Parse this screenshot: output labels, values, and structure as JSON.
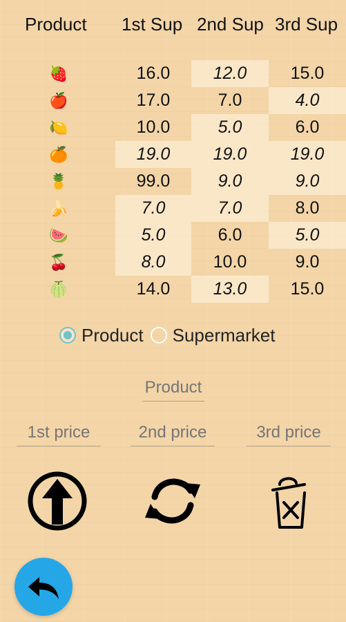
{
  "table": {
    "headers": {
      "product": "Product",
      "sup1": "1st Sup",
      "sup2": "2nd Sup",
      "sup3": "3rd Sup"
    },
    "rows": [
      {
        "icon": "🍓",
        "icon_name": "strawberry-icon",
        "p1": "16.0",
        "p2": "12.0",
        "p3": "15.0",
        "hl": [
          false,
          true,
          false
        ]
      },
      {
        "icon": "🍎",
        "icon_name": "apple-icon",
        "p1": "17.0",
        "p2": "7.0",
        "p3": "4.0",
        "hl": [
          false,
          false,
          true
        ]
      },
      {
        "icon": "🍋",
        "icon_name": "lemon-icon",
        "p1": "10.0",
        "p2": "5.0",
        "p3": "6.0",
        "hl": [
          false,
          true,
          false
        ]
      },
      {
        "icon": "🍊",
        "icon_name": "orange-icon",
        "p1": "19.0",
        "p2": "19.0",
        "p3": "19.0",
        "hl": [
          true,
          true,
          true
        ]
      },
      {
        "icon": "🍍",
        "icon_name": "pineapple-icon",
        "p1": "99.0",
        "p2": "9.0",
        "p3": "9.0",
        "hl": [
          false,
          true,
          true
        ]
      },
      {
        "icon": "🍌",
        "icon_name": "banana-icon",
        "p1": "7.0",
        "p2": "7.0",
        "p3": "8.0",
        "hl": [
          true,
          true,
          false
        ]
      },
      {
        "icon": "🍉",
        "icon_name": "watermelon-icon",
        "p1": "5.0",
        "p2": "6.0",
        "p3": "5.0",
        "hl": [
          true,
          false,
          true
        ]
      },
      {
        "icon": "🍒",
        "icon_name": "cherries-icon",
        "p1": "8.0",
        "p2": "10.0",
        "p3": "9.0",
        "hl": [
          true,
          false,
          false
        ]
      },
      {
        "icon": "🍈",
        "icon_name": "melon-icon",
        "p1": "14.0",
        "p2": "13.0",
        "p3": "15.0",
        "hl": [
          false,
          true,
          false
        ]
      }
    ]
  },
  "radio": {
    "options": [
      {
        "label": "Product",
        "selected": true
      },
      {
        "label": "Supermarket",
        "selected": false
      }
    ]
  },
  "form": {
    "product_placeholder": "Product",
    "price_placeholders": [
      "1st price",
      "2nd price",
      "3rd price"
    ]
  },
  "actions": {
    "upload_icon": "upload-icon",
    "refresh_icon": "refresh-icon",
    "delete_icon": "trash-delete-icon",
    "back_icon": "back-arrow-icon"
  },
  "colors": {
    "background": "#f3d5a8",
    "radio_accent": "#6fc3c9",
    "fab": "#25a7e7",
    "highlight": "rgba(255,245,225,0.55)"
  }
}
